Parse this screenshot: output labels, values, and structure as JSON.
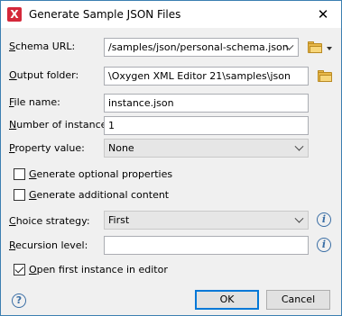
{
  "window": {
    "title": "Generate Sample JSON Files",
    "app_icon": "oxygen-x-icon",
    "close_glyph": "✕"
  },
  "schema_url": {
    "label_pre": "",
    "label_key": "S",
    "label_post": "chema URL:",
    "value": "/samples/json/personal-schema.json"
  },
  "output_folder": {
    "label_pre": "",
    "label_key": "O",
    "label_post": "utput folder:",
    "value": "\\Oxygen XML Editor 21\\samples\\json"
  },
  "file_name": {
    "label_pre": "",
    "label_key": "F",
    "label_post": "ile name:",
    "value": "instance.json"
  },
  "number_of_instances": {
    "label_pre": "",
    "label_key": "N",
    "label_post": "umber of instances:",
    "value": "1"
  },
  "property_value": {
    "label_pre": "",
    "label_key": "P",
    "label_post": "roperty value:",
    "value": "None"
  },
  "generate_optional": {
    "label_pre": "",
    "label_key": "G",
    "label_post": "enerate optional properties",
    "checked": false
  },
  "generate_additional": {
    "label_pre": "",
    "label_key": "G",
    "label_post": "enerate additional content",
    "checked": false
  },
  "choice_strategy": {
    "label_pre": "",
    "label_key": "C",
    "label_post": "hoice strategy:",
    "value": "First"
  },
  "recursion_level": {
    "label_pre": "",
    "label_key": "R",
    "label_post": "ecursion level:",
    "value": ""
  },
  "open_first": {
    "label_pre": "",
    "label_key": "O",
    "label_post": "pen first instance in editor",
    "checked": true
  },
  "buttons": {
    "ok": "OK",
    "cancel": "Cancel"
  },
  "icons": {
    "info_glyph": "i",
    "help_glyph": "?"
  },
  "colors": {
    "accent": "#0078d7",
    "app_red": "#d4283a",
    "info_blue": "#3a6ea5",
    "folder": "#e8b84a"
  }
}
